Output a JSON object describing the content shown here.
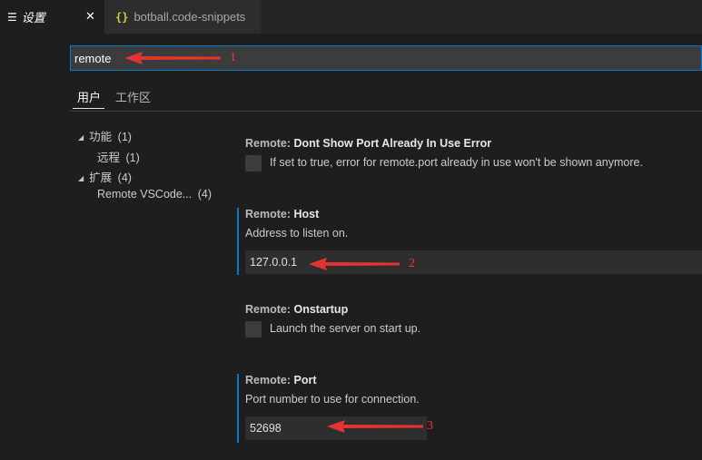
{
  "tabs": [
    {
      "label": "设置",
      "close": "✕"
    },
    {
      "label": "botball.code-snippets",
      "icon": "{}"
    }
  ],
  "search": {
    "value": "remote"
  },
  "scopes": [
    {
      "label": "用户"
    },
    {
      "label": "工作区"
    }
  ],
  "toc": [
    {
      "label": "功能",
      "count": "(1)"
    },
    {
      "label": "远程",
      "count": "(1)"
    },
    {
      "label": "扩展",
      "count": "(4)"
    },
    {
      "label": "Remote VSCode...",
      "count": "(4)"
    }
  ],
  "settings": [
    {
      "category": "Remote: ",
      "key": "Dont Show Port Already In Use Error",
      "description": "If set to true, error for remote.port already in use won't be shown anymore."
    },
    {
      "category": "Remote: ",
      "key": "Host",
      "description": "Address to listen on.",
      "value": "127.0.0.1"
    },
    {
      "category": "Remote: ",
      "key": "Onstartup",
      "description": "Launch the server on start up."
    },
    {
      "category": "Remote: ",
      "key": "Port",
      "description": "Port number to use for connection.",
      "value": "52698"
    }
  ],
  "annotations": {
    "one": "1",
    "two": "2",
    "three": "3"
  },
  "colors": {
    "accent": "#007acc",
    "annotation": "#e33333",
    "background": "#1e1e1e"
  }
}
